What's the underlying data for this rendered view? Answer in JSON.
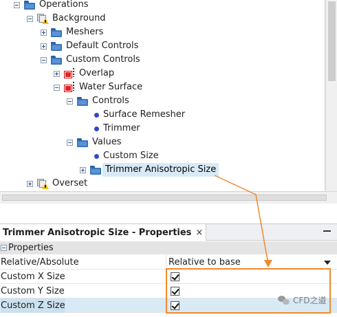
{
  "tree": {
    "items": [
      {
        "id": "operations",
        "label": "Operations",
        "icon": "folder-icon",
        "toggle": "minus"
      },
      {
        "id": "background",
        "label": "Background",
        "icon": "operation-warning-icon",
        "toggle": "minus"
      },
      {
        "id": "meshers",
        "label": "Meshers",
        "icon": "folder-icon",
        "toggle": "plus"
      },
      {
        "id": "default-controls",
        "label": "Default Controls",
        "icon": "folder-icon",
        "toggle": "plus"
      },
      {
        "id": "custom-controls",
        "label": "Custom Controls",
        "icon": "folder-icon",
        "toggle": "minus"
      },
      {
        "id": "overlap",
        "label": "Overlap",
        "icon": "custom-control-icon",
        "toggle": "plus"
      },
      {
        "id": "water-surface",
        "label": "Water Surface",
        "icon": "custom-control-icon",
        "toggle": "minus"
      },
      {
        "id": "controls",
        "label": "Controls",
        "icon": "folder-icon",
        "toggle": "minus"
      },
      {
        "id": "surface-remesher",
        "label": "Surface Remesher",
        "icon": "blue-dot-icon",
        "toggle": "none"
      },
      {
        "id": "trimmer",
        "label": "Trimmer",
        "icon": "blue-dot-icon",
        "toggle": "none"
      },
      {
        "id": "values",
        "label": "Values",
        "icon": "folder-icon",
        "toggle": "minus"
      },
      {
        "id": "custom-size",
        "label": "Custom Size",
        "icon": "blue-dot-icon",
        "toggle": "none"
      },
      {
        "id": "trimmer-anisotropic-size",
        "label": "Trimmer Anisotropic Size",
        "icon": "folder-icon",
        "toggle": "plus",
        "selected": true
      },
      {
        "id": "overset",
        "label": "Overset",
        "icon": "operation-warning-icon",
        "toggle": "plus"
      }
    ]
  },
  "properties": {
    "tab_title": "Trimmer Anisotropic Size - Properties",
    "close_glyph": "×",
    "section_title": "Properties",
    "rows": [
      {
        "name": "Relative/Absolute",
        "type": "dropdown",
        "value": "Relative to base"
      },
      {
        "name": "Custom X Size",
        "type": "checkbox",
        "checked": true
      },
      {
        "name": "Custom Y Size",
        "type": "checkbox",
        "checked": true
      },
      {
        "name": "Custom Z Size",
        "type": "checkbox",
        "checked": true
      }
    ]
  },
  "watermark": {
    "text": "CFD之道"
  },
  "colors": {
    "accent_annotation": "#f0892c",
    "selection": "#d9eaf7",
    "folder": "#3a75bf"
  }
}
